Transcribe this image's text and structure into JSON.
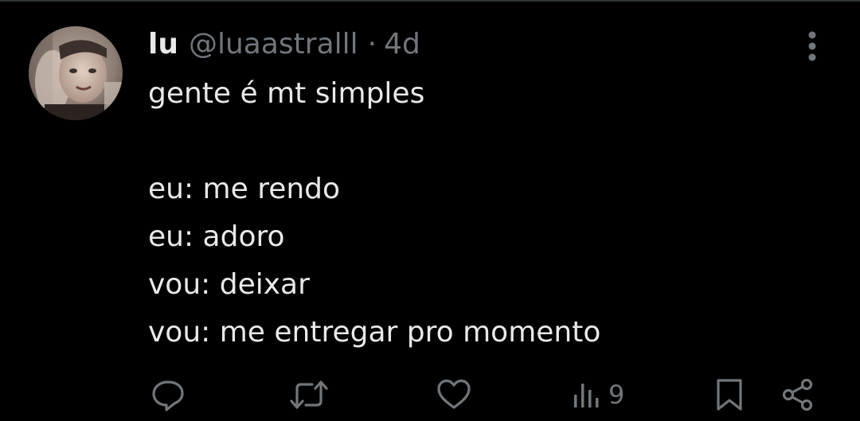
{
  "tweet": {
    "display_name": "lu",
    "handle": "@luaastralll",
    "separator": "·",
    "time": "4d",
    "lines": [
      "gente é mt simples",
      "",
      "eu: me rendo",
      "eu: adoro",
      "vou: deixar",
      "vou: me entregar pro momento"
    ]
  },
  "actions": {
    "reply_icon": "reply-icon",
    "retweet_icon": "retweet-icon",
    "like_icon": "heart-icon",
    "views_icon": "views-icon",
    "views_count": "9",
    "bookmark_icon": "bookmark-icon",
    "share_icon": "share-icon"
  },
  "colors": {
    "background": "#000000",
    "primary_text": "#e7e9ea",
    "secondary_text": "#71767b",
    "divider": "#2f3336"
  }
}
